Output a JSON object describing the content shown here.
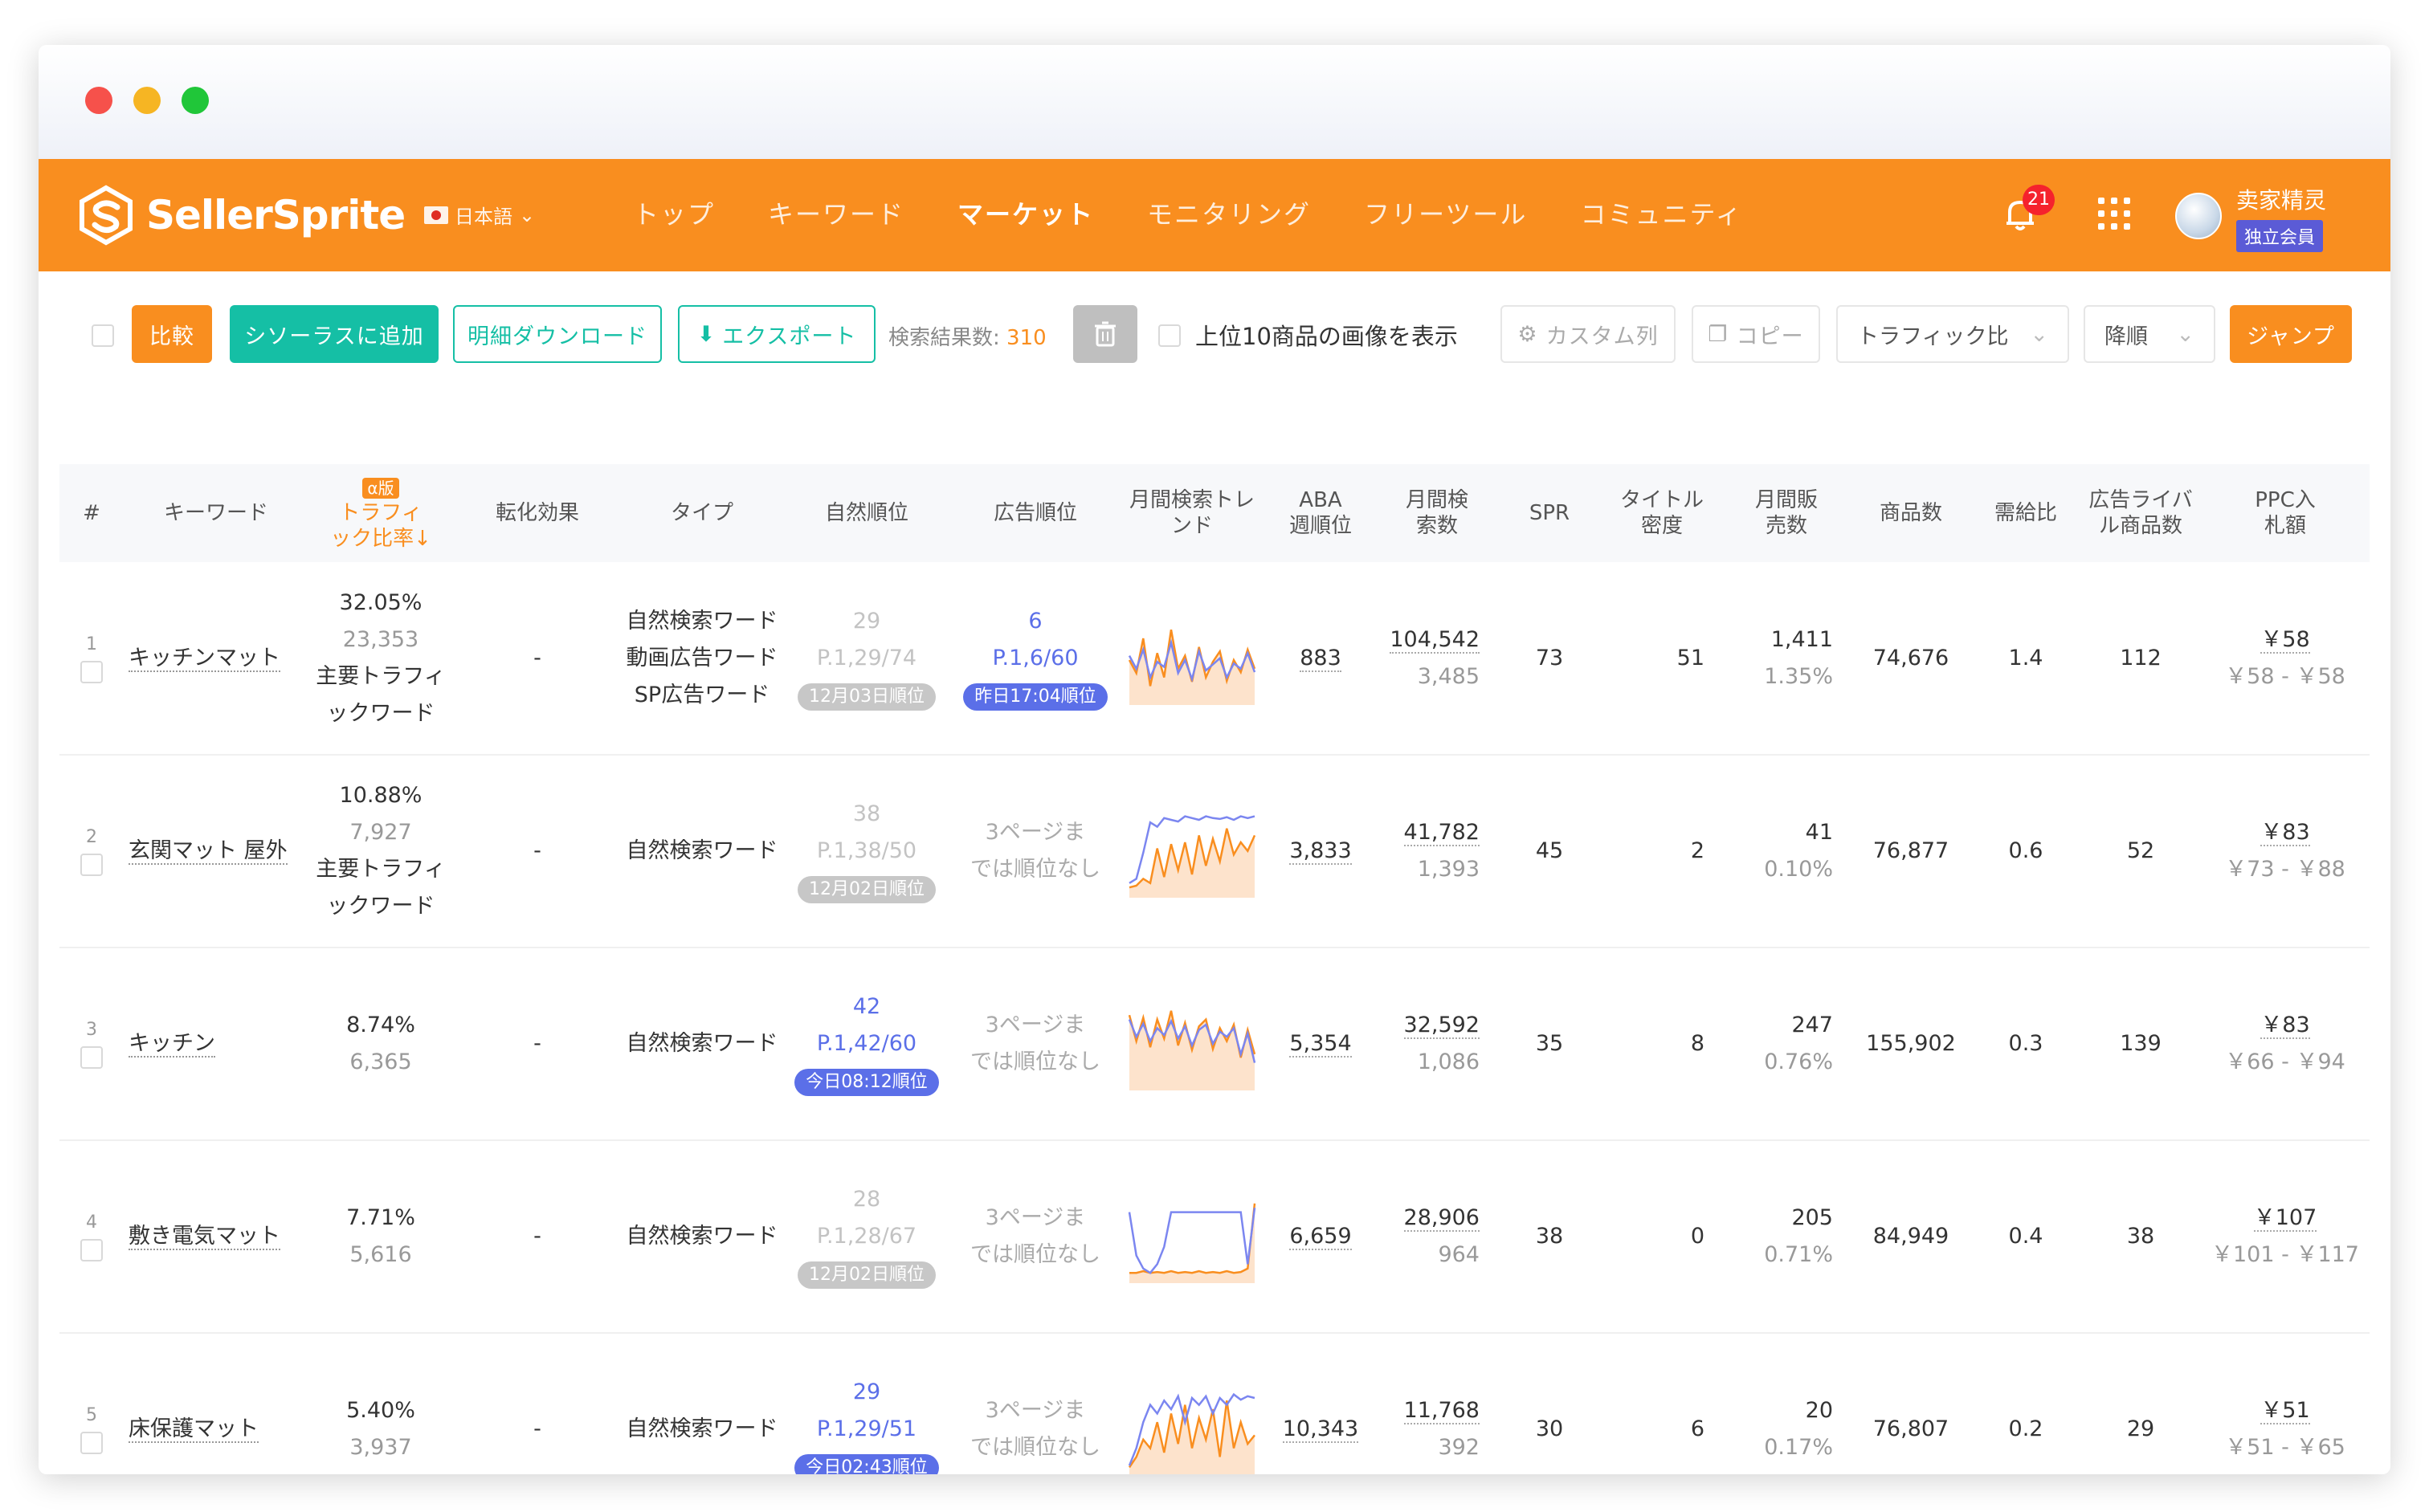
{
  "nav": {
    "logo_text": "SellerSprite",
    "lang": "日本語",
    "menu": [
      "トップ",
      "キーワード",
      "マーケット",
      "モニタリング",
      "フリーツール",
      "コミュニティ"
    ],
    "notification_count": "21",
    "user_name": "卖家精灵",
    "member_badge": "独立会員",
    "accent_color": "#f98e1f"
  },
  "toolbar": {
    "compare": "比較",
    "add_thesaurus": "シソーラスに追加",
    "detail_download": "明細ダウンロード",
    "export": "エクスポート",
    "result_label": "検索結果数:",
    "result_count": "310",
    "show_images": "上位10商品の画像を表示",
    "custom_columns": "カスタム列",
    "copy": "コピー",
    "sort_field": "トラフィック比",
    "sort_order": "降順",
    "jump": "ジャンプ"
  },
  "table": {
    "headers": {
      "num": "#",
      "keyword": "キーワード",
      "alpha": "α版",
      "traffic_line1": "トラフィ",
      "traffic_line2": "ック比率↓",
      "conversion": "転化効果",
      "type": "タイプ",
      "natural_rank": "自然順位",
      "ad_rank": "広告順位",
      "trend_line1": "月間検索トレ",
      "trend_line2": "ンド",
      "aba_line1": "ABA",
      "aba_line2": "週順位",
      "monthly_search_line1": "月間検",
      "monthly_search_line2": "索数",
      "spr": "SPR",
      "title_density_line1": "タイトル",
      "title_density_line2": "密度",
      "monthly_sales_line1": "月間販",
      "monthly_sales_line2": "売数",
      "products": "商品数",
      "supply_demand": "需給比",
      "ad_rivals_line1": "広告ライバ",
      "ad_rivals_line2": "ル商品数",
      "ppc_line1": "PPC入",
      "ppc_line2": "札額"
    },
    "rows": [
      {
        "num": "1",
        "keyword": "キッチンマット",
        "traffic_pct": "32.05%",
        "traffic_num": "23,353",
        "traffic_tag1": "主要トラフィ",
        "traffic_tag2": "ックワード",
        "conversion": "-",
        "types": [
          "自然検索ワード",
          "動画広告ワード",
          "SP広告ワード"
        ],
        "nat_rank": "29",
        "nat_page": "P.1,29/74",
        "nat_date": "12月03日順位",
        "ad_rank": "6",
        "ad_page": "P.1,6/60",
        "ad_date": "昨日17:04順位",
        "ad_none1": "",
        "ad_none2": "",
        "aba": "883",
        "search": "104,542",
        "search_sub": "3,485",
        "spr": "73",
        "density": "51",
        "sales": "1,411",
        "sales_pct": "1.35%",
        "products": "74,676",
        "ratio": "1.4",
        "rivals": "112",
        "ppc": "￥58",
        "ppc_range": "￥58 - ￥58",
        "trend_blue": [
          55,
          40,
          62,
          30,
          48,
          42,
          70,
          35,
          50,
          28,
          60,
          38,
          45,
          52,
          30,
          46,
          40,
          58,
          36
        ],
        "trend_orange": [
          50,
          35,
          75,
          20,
          58,
          30,
          85,
          40,
          55,
          25,
          65,
          30,
          48,
          60,
          26,
          50,
          36,
          62,
          40
        ]
      },
      {
        "num": "2",
        "keyword": "玄関マット 屋外",
        "traffic_pct": "10.88%",
        "traffic_num": "7,927",
        "traffic_tag1": "主要トラフィ",
        "traffic_tag2": "ックワード",
        "conversion": "-",
        "types": [
          "自然検索ワード"
        ],
        "nat_rank": "38",
        "nat_page": "P.1,38/50",
        "nat_date": "12月02日順位",
        "ad_rank": "",
        "ad_page": "",
        "ad_date": "",
        "ad_none1": "3ページま",
        "ad_none2": "では順位なし",
        "aba": "3,833",
        "search": "41,782",
        "search_sub": "1,393",
        "spr": "45",
        "density": "2",
        "sales": "41",
        "sales_pct": "0.10%",
        "products": "76,877",
        "ratio": "0.6",
        "rivals": "52",
        "ppc": "￥83",
        "ppc_range": "￥73 - ￥88",
        "trend_blue": [
          15,
          20,
          50,
          85,
          80,
          90,
          88,
          86,
          92,
          90,
          88,
          92,
          90,
          89,
          91,
          88,
          92,
          90,
          92
        ],
        "trend_orange": [
          10,
          12,
          20,
          15,
          55,
          22,
          60,
          30,
          62,
          25,
          70,
          35,
          66,
          40,
          78,
          48,
          62,
          52,
          70
        ]
      },
      {
        "num": "3",
        "keyword": "キッチン",
        "traffic_pct": "8.74%",
        "traffic_num": "6,365",
        "traffic_tag1": "",
        "traffic_tag2": "",
        "conversion": "-",
        "types": [
          "自然検索ワード"
        ],
        "nat_rank": "42",
        "nat_page": "P.1,42/60",
        "nat_date": "今日08:12順位",
        "ad_rank": "",
        "ad_page": "",
        "ad_date": "",
        "ad_none1": "3ページま",
        "ad_none2": "では順位なし",
        "aba": "5,354",
        "search": "32,592",
        "search_sub": "1,086",
        "spr": "35",
        "density": "8",
        "sales": "247",
        "sales_pct": "0.76%",
        "products": "155,902",
        "ratio": "0.3",
        "rivals": "139",
        "ppc": "￥83",
        "ppc_range": "￥66 - ￥94",
        "trend_blue": [
          80,
          60,
          75,
          55,
          70,
          62,
          78,
          58,
          72,
          50,
          68,
          74,
          52,
          66,
          60,
          70,
          40,
          64,
          30
        ],
        "trend_orange": [
          85,
          55,
          82,
          48,
          80,
          58,
          90,
          50,
          76,
          45,
          72,
          80,
          46,
          70,
          55,
          74,
          36,
          68,
          40
        ]
      },
      {
        "num": "4",
        "keyword": "敷き電気マット",
        "traffic_pct": "7.71%",
        "traffic_num": "5,616",
        "traffic_tag1": "",
        "traffic_tag2": "",
        "conversion": "-",
        "types": [
          "自然検索ワード"
        ],
        "nat_rank": "28",
        "nat_page": "P.1,28/67",
        "nat_date": "12月02日順位",
        "ad_rank": "",
        "ad_page": "",
        "ad_date": "",
        "ad_none1": "3ページま",
        "ad_none2": "では順位なし",
        "aba": "6,659",
        "search": "28,906",
        "search_sub": "964",
        "spr": "38",
        "density": "0",
        "sales": "205",
        "sales_pct": "0.71%",
        "products": "84,949",
        "ratio": "0.4",
        "rivals": "38",
        "ppc": "￥107",
        "ppc_range": "￥101 - ￥117",
        "trend_blue": [
          80,
          30,
          15,
          10,
          20,
          40,
          80,
          80,
          80,
          80,
          80,
          80,
          80,
          80,
          80,
          80,
          80,
          20,
          85
        ],
        "trend_orange": [
          10,
          10,
          12,
          10,
          11,
          10,
          12,
          10,
          11,
          10,
          12,
          10,
          11,
          10,
          12,
          10,
          11,
          15,
          90
        ]
      },
      {
        "num": "5",
        "keyword": "床保護マット",
        "traffic_pct": "5.40%",
        "traffic_num": "3,937",
        "traffic_tag1": "",
        "traffic_tag2": "",
        "conversion": "-",
        "types": [
          "自然検索ワード"
        ],
        "nat_rank": "29",
        "nat_page": "P.1,29/51",
        "nat_date": "今日02:43順位",
        "ad_rank": "",
        "ad_page": "",
        "ad_date": "",
        "ad_none1": "3ページま",
        "ad_none2": "では順位なし",
        "aba": "10,343",
        "search": "11,768",
        "search_sub": "392",
        "spr": "30",
        "density": "6",
        "sales": "20",
        "sales_pct": "0.17%",
        "products": "76,807",
        "ratio": "0.2",
        "rivals": "29",
        "ppc": "￥51",
        "ppc_range": "￥51 - ￥65",
        "trend_blue": [
          10,
          30,
          60,
          80,
          70,
          85,
          75,
          90,
          60,
          88,
          80,
          90,
          70,
          88,
          80,
          92,
          86,
          90,
          88
        ],
        "trend_orange": [
          8,
          20,
          40,
          30,
          60,
          25,
          70,
          35,
          80,
          30,
          65,
          40,
          75,
          20,
          85,
          30,
          60,
          35,
          45
        ]
      }
    ]
  }
}
